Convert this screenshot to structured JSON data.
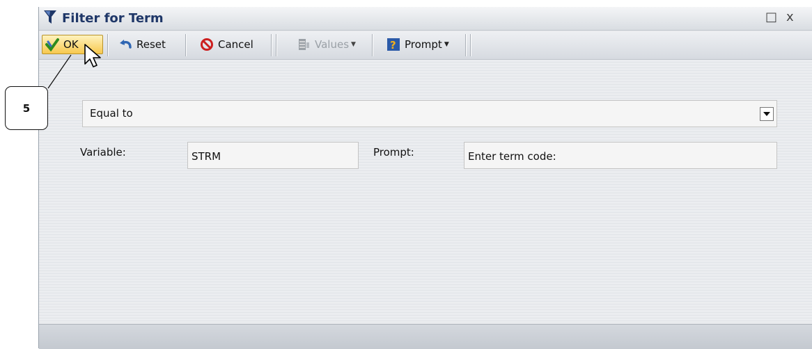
{
  "window": {
    "title": "Filter for Term",
    "maximize_glyph": "□",
    "close_glyph": "x"
  },
  "toolbar": {
    "ok_label": "OK",
    "reset_label": "Reset",
    "cancel_label": "Cancel",
    "values_label": "Values",
    "prompt_label": "Prompt"
  },
  "filter": {
    "operator": "Equal to",
    "variable_label": "Variable:",
    "variable_value": "STRM",
    "prompt_label": "Prompt:",
    "prompt_value": "Enter term code:"
  },
  "callout": {
    "number": "5"
  },
  "icons": {
    "title": "funnel-icon",
    "ok": "checkmark-icon",
    "reset": "reset-arrow-icon",
    "cancel": "cancel-icon",
    "values": "values-icon",
    "prompt": "prompt-icon",
    "cursor": "mouse-cursor-icon"
  },
  "colors": {
    "title": "#1f3768",
    "ok_highlight": "#f7c84e",
    "cancel_red": "#cc1f1f",
    "check_green": "#2e8b1e"
  }
}
